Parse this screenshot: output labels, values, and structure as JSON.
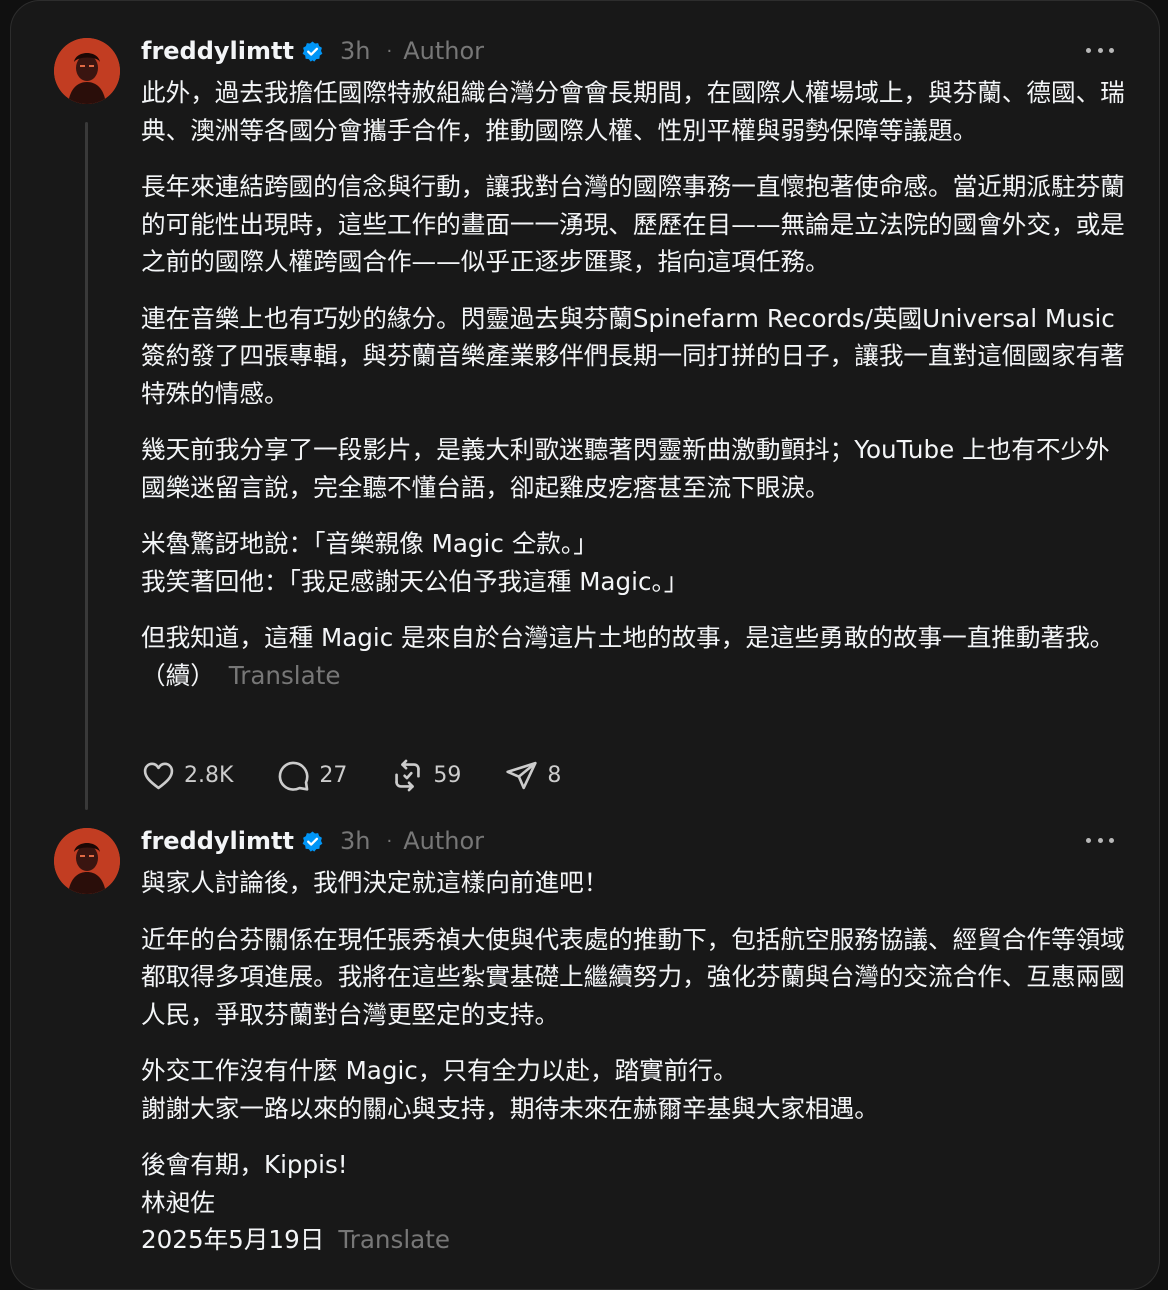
{
  "posts": [
    {
      "username": "freddylimtt",
      "time": "3h",
      "separator": "·",
      "badge": "Author",
      "paragraphs": [
        "此外，過去我擔任國際特赦組織台灣分會會長期間，在國際人權場域上，與芬蘭、德國、瑞典、澳洲等各國分會攜手合作，推動國際人權、性別平權與弱勢保障等議題。",
        "長年來連結跨國的信念與行動，讓我對台灣的國際事務一直懷抱著使命感。當近期派駐芬蘭的可能性出現時，這些工作的畫面一一湧現、歷歷在目——無論是立法院的國會外交，或是之前的國際人權跨國合作——似乎正逐步匯聚，指向這項任務。",
        "連在音樂上也有巧妙的緣分。閃靈過去與芬蘭Spinefarm Records/英國Universal Music簽約發了四張專輯，與芬蘭音樂產業夥伴們長期一同打拼的日子，讓我一直對這個國家有著特殊的情感。",
        "幾天前我分享了一段影片，是義大利歌迷聽著閃靈新曲激動顫抖；YouTube 上也有不少外國樂迷留言說，完全聽不懂台語，卻起雞皮疙瘩甚至流下眼淚。",
        "米魯驚訝地說：「音樂親像 Magic 仝款。」\n我笑著回他：「我足感謝天公伯予我這種 Magic。」",
        "但我知道，這種 Magic 是來自於台灣這片土地的故事，是這些勇敢的故事一直推動著我。（續）"
      ],
      "translate_label": "Translate",
      "actions": {
        "likes": "2.8K",
        "comments": "27",
        "reposts": "59",
        "shares": "8"
      }
    },
    {
      "username": "freddylimtt",
      "time": "3h",
      "separator": "·",
      "badge": "Author",
      "paragraphs": [
        "與家人討論後，我們決定就這樣向前進吧！",
        "近年的台芬關係在現任張秀禎大使與代表處的推動下，包括航空服務協議、經貿合作等領域都取得多項進展。我將在這些紮實基礎上繼續努力，強化芬蘭與台灣的交流合作、互惠兩國人民，爭取芬蘭對台灣更堅定的支持。",
        "外交工作沒有什麼 Magic，只有全力以赴，踏實前行。\n謝謝大家一路以來的關心與支持，期待未來在赫爾辛基與大家相遇。",
        "後會有期，Kippis!\n林昶佐\n2025年5月19日"
      ],
      "translate_label": "Translate"
    }
  ],
  "icons": {
    "verified": "verified-badge-icon",
    "like": "heart-icon",
    "comment": "comment-bubble-icon",
    "repost": "repost-icon",
    "share": "send-icon",
    "more": "more-options-icon"
  },
  "colors": {
    "background": "#181818",
    "text": "#f3f5f7",
    "muted": "#777777",
    "verified": "#0095f6"
  }
}
